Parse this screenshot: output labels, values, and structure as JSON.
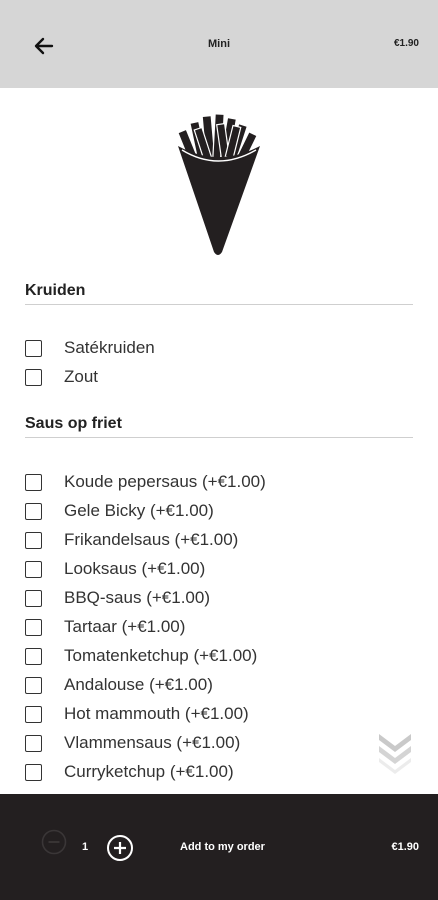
{
  "header": {
    "title": "Mini",
    "price": "€1.90",
    "back_icon": "arrow-left-icon"
  },
  "hero": {
    "icon": "fries-cone-icon"
  },
  "sections": {
    "kruiden": {
      "title": "Kruiden",
      "options": [
        "Satékruiden",
        "Zout"
      ]
    },
    "sauzen": {
      "title": "Saus op friet",
      "options": [
        "Koude pepersaus (+€1.00)",
        "Gele Bicky (+€1.00)",
        "Frikandelsaus (+€1.00)",
        "Looksaus (+€1.00)",
        "BBQ-saus (+€1.00)",
        "Tartaar (+€1.00)",
        "Tomatenketchup (+€1.00)",
        "Andalouse (+€1.00)",
        "Hot mammouth (+€1.00)",
        "Vlammensaus (+€1.00)",
        "Curryketchup (+€1.00)"
      ]
    }
  },
  "scroll_hint_icon": "double-chevron-down-icon",
  "footer": {
    "quantity": "1",
    "add_label": "Add to my order",
    "price": "€1.90",
    "minus_icon": "minus-circle-icon",
    "plus_icon": "plus-circle-icon"
  },
  "colors": {
    "topbar": "#d6d6d6",
    "bottombar": "#231f20",
    "text": "#222222"
  }
}
